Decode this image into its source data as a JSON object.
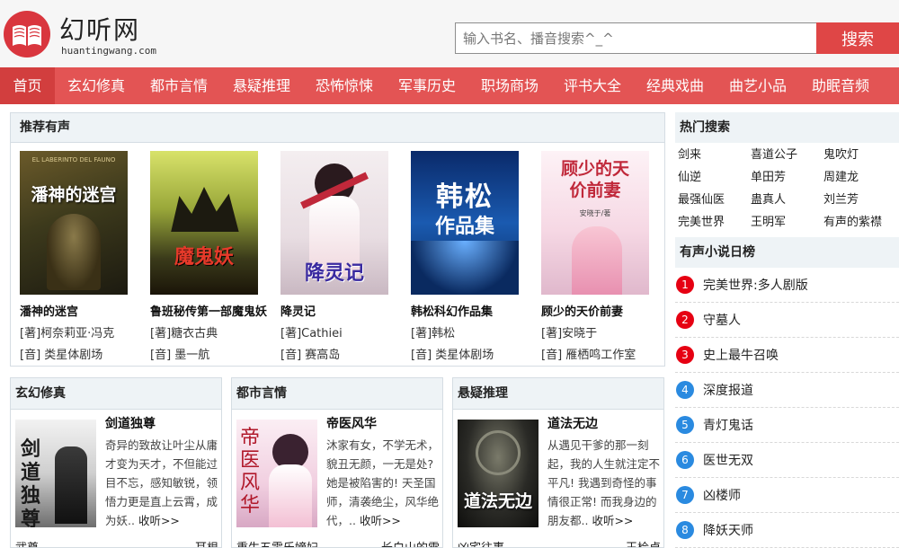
{
  "site": {
    "title": "幻听网",
    "domain": "huantingwang.com",
    "brand_color": "#e35454"
  },
  "search": {
    "placeholder": "输入书名、播音搜索^_^",
    "button_label": "搜索"
  },
  "nav": {
    "items": [
      {
        "label": "首页",
        "active": true
      },
      {
        "label": "玄幻修真"
      },
      {
        "label": "都市言情"
      },
      {
        "label": "悬疑推理"
      },
      {
        "label": "恐怖惊悚"
      },
      {
        "label": "军事历史"
      },
      {
        "label": "职场商场"
      },
      {
        "label": "评书大全"
      },
      {
        "label": "经典戏曲"
      },
      {
        "label": "曲艺小品"
      },
      {
        "label": "助眠音频"
      }
    ]
  },
  "recommend": {
    "heading": "推荐有声",
    "items": [
      {
        "title": "潘神的迷宫",
        "author": "[著]柯奈莉亚·冯克",
        "narrator": "[音] 类星体剧场",
        "cover_text": "潘神的迷宫",
        "cover_top_text": "EL LABERINTO DEL FAUNO"
      },
      {
        "title": "鲁班秘传第一部魔鬼妖",
        "author": "[著]糖衣古典",
        "narrator": "[音] 墨一航",
        "cover_text": "魔鬼妖",
        "cover_top_text": ""
      },
      {
        "title": "降灵记",
        "author": "[著]Cathiei",
        "narrator": "[音] 赛高岛",
        "cover_text": "降灵记",
        "cover_top_text": ""
      },
      {
        "title": "韩松科幻作品集",
        "author": "[著]韩松",
        "narrator": "[音] 类星体剧场",
        "cover_text": "韩松",
        "cover_sub_text": "作品集"
      },
      {
        "title": "顾少的天价前妻",
        "author": "[著]安晓于",
        "narrator": "[音] 雁栖鸣工作室",
        "cover_text": "顾少的天价前妻",
        "cover_sub_text": "安晓于/著"
      }
    ]
  },
  "hot_search": {
    "heading": "热门搜索",
    "links": [
      "剑来",
      "喜道公子",
      "鬼吹灯",
      "仙逆",
      "单田芳",
      "周建龙",
      "最强仙医",
      "蛊真人",
      "刘兰芳",
      "完美世界",
      "王明军",
      "有声的紫襟"
    ]
  },
  "daily_rank": {
    "heading": "有声小说日榜",
    "items": [
      {
        "num": "1",
        "title": "完美世界:多人剧版",
        "color": "#e60012"
      },
      {
        "num": "2",
        "title": "守墓人",
        "color": "#e60012"
      },
      {
        "num": "3",
        "title": "史上最牛召唤",
        "color": "#e60012"
      },
      {
        "num": "4",
        "title": "深度报道",
        "color": "#2a8ae0"
      },
      {
        "num": "5",
        "title": "青灯鬼话",
        "color": "#2a8ae0"
      },
      {
        "num": "6",
        "title": "医世无双",
        "color": "#2a8ae0"
      },
      {
        "num": "7",
        "title": "凶楼师",
        "color": "#2a8ae0"
      },
      {
        "num": "8",
        "title": "降妖天师",
        "color": "#2a8ae0"
      }
    ]
  },
  "categories": [
    {
      "heading": "玄幻修真",
      "book_title": "剑道独尊",
      "cover_text": "剑道独尊",
      "desc": "奇异的致故让叶尘从庸才变为天才，不但能过目不忘，感知敏锐，领悟力更是直上云霄，成为妖..",
      "more": "收听>>",
      "footer_left": "武尊",
      "footer_right": "耳根"
    },
    {
      "heading": "都市言情",
      "book_title": "帝医风华",
      "cover_text": "帝医风华",
      "desc": "沐家有女，不学无术，貌丑无颜，一无是处?她是被陷害的! 天圣国师，清袭绝尘，风华绝代，..",
      "more": "收听>>",
      "footer_left": "重生五零乐嫡妇",
      "footer_right": "长白山的雪"
    },
    {
      "heading": "悬疑推理",
      "book_title": "道法无边",
      "cover_text": "道法无边",
      "desc": "从遇见干爹的那一刻起，我的人生就注定不平凡! 我遇到奇怪的事情很正常! 而我身边的朋友都..",
      "more": "收听>>",
      "footer_left": "凶宅往事",
      "footer_right": "王检卓"
    }
  ]
}
